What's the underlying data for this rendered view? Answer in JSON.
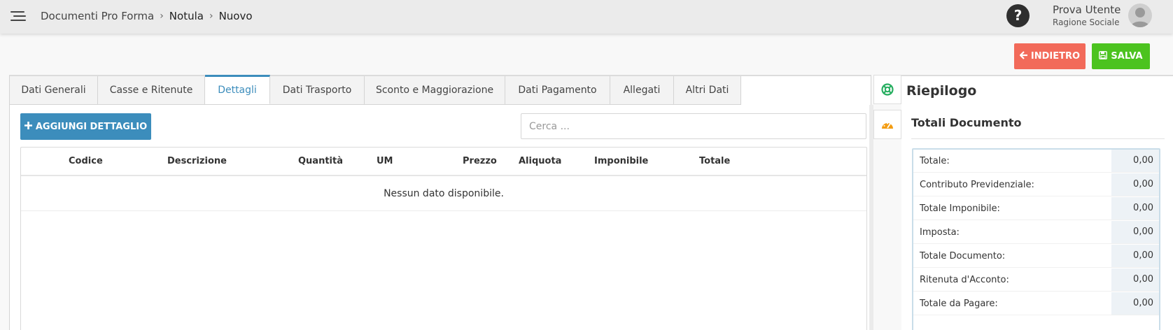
{
  "header": {
    "breadcrumb": [
      "Documenti Pro Forma",
      "Notula",
      "Nuovo"
    ],
    "help_glyph": "?",
    "user": {
      "name": "Prova Utente",
      "company": "Ragione Sociale"
    }
  },
  "actions": {
    "back_label": "INDIETRO",
    "save_label": "SALVA",
    "back_color": "#f26a5a",
    "save_color": "#4cc31f"
  },
  "tabs": [
    {
      "label": "Dati Generali",
      "active": false
    },
    {
      "label": "Casse e Ritenute",
      "active": false
    },
    {
      "label": "Dettagli",
      "active": true
    },
    {
      "label": "Dati Trasporto",
      "active": false
    },
    {
      "label": "Sconto e Maggiorazione",
      "active": false
    },
    {
      "label": "Dati Pagamento",
      "active": false
    },
    {
      "label": "Allegati",
      "active": false
    },
    {
      "label": "Altri Dati",
      "active": false
    }
  ],
  "details": {
    "add_label": "AGGIUNGI DETTAGLIO",
    "search_placeholder": "Cerca ...",
    "columns": [
      "Codice",
      "Descrizione",
      "Quantità",
      "UM",
      "Prezzo",
      "Aliquota",
      "Imponibile",
      "Totale"
    ],
    "empty_message": "Nessun dato disponibile."
  },
  "summary": {
    "title": "Riepilogo",
    "totals_title": "Totali Documento",
    "rows": [
      {
        "label": "Totale:",
        "value": "0,00"
      },
      {
        "label": "Contributo Previdenziale:",
        "value": "0,00"
      },
      {
        "label": "Totale Imponibile:",
        "value": "0,00"
      },
      {
        "label": "Imposta:",
        "value": "0,00"
      },
      {
        "label": "Totale Documento:",
        "value": "0,00"
      },
      {
        "label": "Ritenuta d'Acconto:",
        "value": "0,00"
      },
      {
        "label": "Totale da Pagare:",
        "value": "0,00"
      }
    ]
  },
  "icons": {
    "menu": "hamburger-menu-icon",
    "help": "question-circle-icon",
    "avatar": "user-avatar-icon",
    "back": "arrow-left-icon",
    "save": "floppy-disk-icon",
    "add": "plus-icon",
    "side_tab_1": "life-ring-icon",
    "side_tab_2": "dashboard-gauge-icon"
  },
  "colors": {
    "primary": "#3c8dbc",
    "accent_green": "#27ae60",
    "accent_orange": "#f39c12"
  }
}
